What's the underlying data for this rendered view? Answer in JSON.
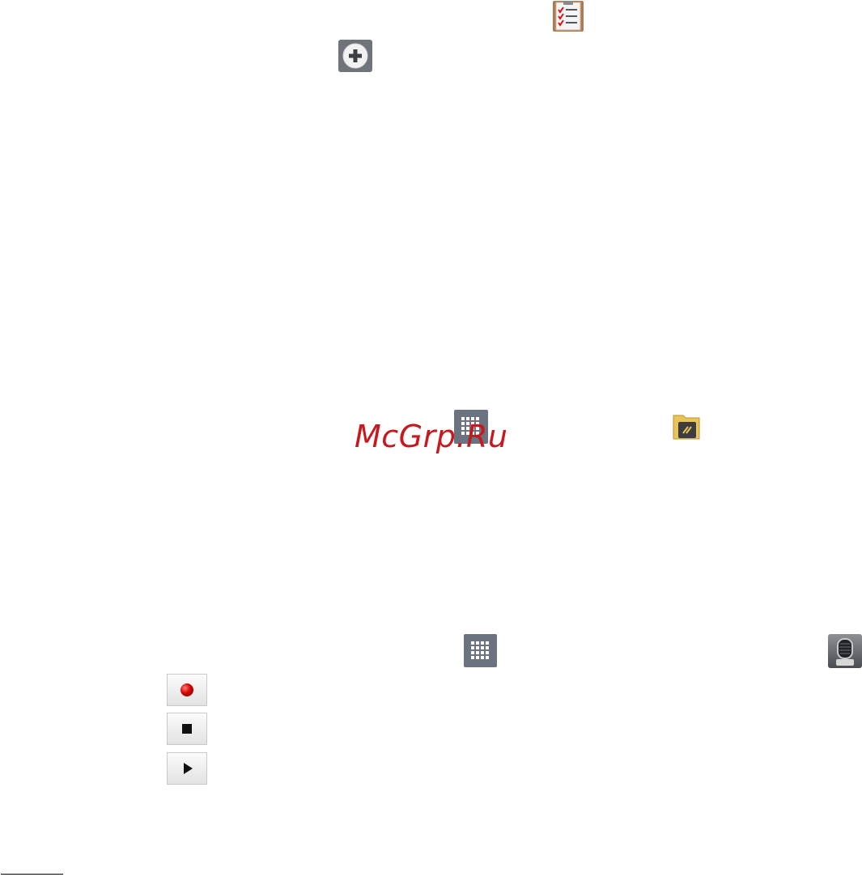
{
  "icons": {
    "tasks": "checklist-icon",
    "add": "plus-circle-icon",
    "apps_top": "apps-grid-icon",
    "notes": "notes-folder-icon",
    "apps_bottom": "apps-grid-icon",
    "voice_recorder": "microphone-icon"
  },
  "watermark": {
    "text": "McGrp.Ru",
    "color": "#c8181e"
  },
  "recorder_controls": {
    "record": "record-dot-icon",
    "stop": "stop-square-icon",
    "play": "play-triangle-icon"
  },
  "colors": {
    "record_red": "#d40000",
    "icon_gray": "#6b7380"
  }
}
